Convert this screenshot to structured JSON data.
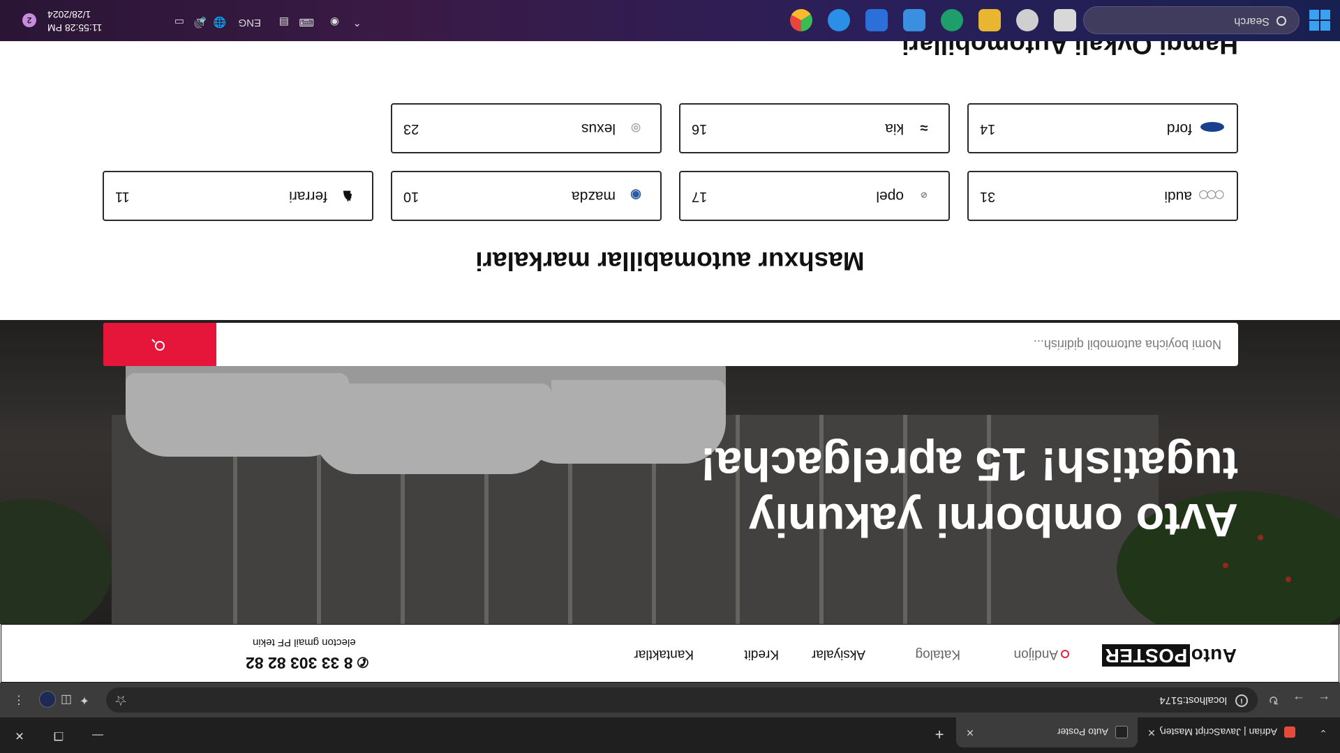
{
  "browser": {
    "tabs": [
      {
        "title": "Adrian | JavaScript Mastery Por",
        "favicon_color": "#e64a3b"
      },
      {
        "title": "Auto Poster",
        "favicon_color": "#222222",
        "active": true
      }
    ],
    "new_tab": "+",
    "url": "localhost:5174"
  },
  "site": {
    "logo": {
      "part1": "Auto",
      "part2": "POSTER"
    },
    "nav": {
      "city": "Andijon",
      "catalog": "Katalog",
      "promo": "Aksiyalar",
      "credit": "Kredit",
      "contacts": "Kantaktlar"
    },
    "phone": "8 33 303 82 82",
    "phone_note": "electon gmail PF tekin",
    "hero_title": "Avto omborni yakuniy tugatish! 15 aprelgacha!",
    "search": {
      "placeholder": "Nomi boyicha automobil qidirish..."
    },
    "brands_title": "Mashxur automabillar markalari",
    "brands": [
      {
        "name": "audi",
        "count": "31",
        "icon": "audi-rings-icon",
        "color": "#999999"
      },
      {
        "name": "opel",
        "count": "17",
        "icon": "opel-bolt-icon",
        "color": "#888888"
      },
      {
        "name": "mazda",
        "count": "10",
        "icon": "mazda-wing-icon",
        "color": "#2a5aa0"
      },
      {
        "name": "ferrari",
        "count": "11",
        "icon": "ferrari-horse-icon",
        "color": "#111111"
      },
      {
        "name": "ford",
        "count": "14",
        "icon": "ford-oval-icon",
        "color": "#1a3f8f"
      },
      {
        "name": "kia",
        "count": "16",
        "icon": "kia-wordmark-icon",
        "color": "#111111"
      },
      {
        "name": "lexus",
        "count": "23",
        "icon": "lexus-emblem-icon",
        "color": "#aaaaaa"
      }
    ],
    "next_section_title": "Hamgi Ovkali Automobillari"
  },
  "taskbar": {
    "search_placeholder": "Search",
    "language": "ENG",
    "time": "11:55:28 PM",
    "date": "1/28/2024",
    "notifications": "2"
  }
}
